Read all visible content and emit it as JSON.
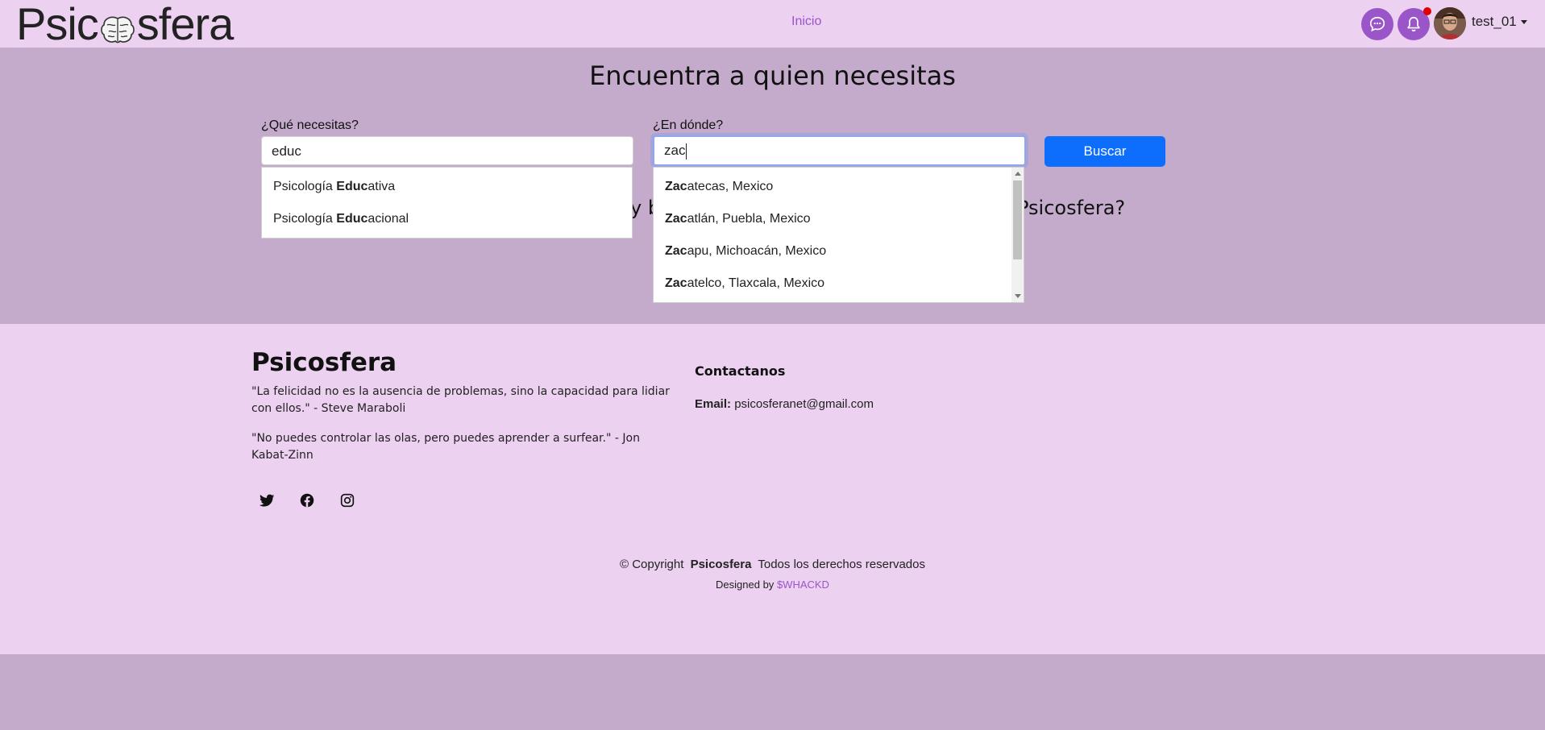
{
  "colors": {
    "navbar_bg": "#ecd1f0",
    "page_bg": "#c4abcb",
    "accent_purple": "#9a55c9",
    "primary_button": "#0d6efd",
    "notification_dot": "#e00000"
  },
  "navbar": {
    "logo_left": "Psic",
    "logo_right": "sfera",
    "logo_icon": "brain-icon",
    "nav_link": "Inicio",
    "chat_icon": "chat-bubble-icon",
    "bell_icon": "bell-icon",
    "username": "test_01"
  },
  "hero": {
    "title": "Encuentra a quien necesitas",
    "what_label": "¿Qué necesitas?",
    "what_value": "educ",
    "where_label": "¿En dónde?",
    "where_value": "zac",
    "search_button": "Buscar",
    "behind_left": "y b",
    "behind_right": "Psicosfera?"
  },
  "what_suggestions": [
    {
      "match": "Educ",
      "prefix": "Psicología ",
      "rest": "ativa"
    },
    {
      "match": "Educ",
      "prefix": "Psicología ",
      "rest": "acional"
    }
  ],
  "where_suggestions": [
    {
      "match": "Zac",
      "rest": "atecas, Mexico"
    },
    {
      "match": "Zac",
      "rest": "atlán, Puebla, Mexico"
    },
    {
      "match": "Zac",
      "rest": "apu, Michoacán, Mexico"
    },
    {
      "match": "Zac",
      "rest": "atelco, Tlaxcala, Mexico"
    }
  ],
  "footer": {
    "title": "Psicosfera",
    "quote1": "\"La felicidad no es la ausencia de problemas, sino la capacidad para lidiar con ellos.\" - Steve Maraboli",
    "quote2": "\"No puedes controlar las olas, pero puedes aprender a surfear.\" - Jon Kabat-Zinn",
    "social_icons": [
      "twitter-icon",
      "facebook-icon",
      "instagram-icon"
    ],
    "contact_title": "Contactanos",
    "email_label": "Email:",
    "email_value": "psicosferanet@gmail.com",
    "copyright_prefix": "© Copyright",
    "copyright_brand": "Psicosfera",
    "copyright_suffix": "Todos los derechos reservados",
    "designed_by_label": "Designed by",
    "designed_by_link": "$WHACKD"
  }
}
